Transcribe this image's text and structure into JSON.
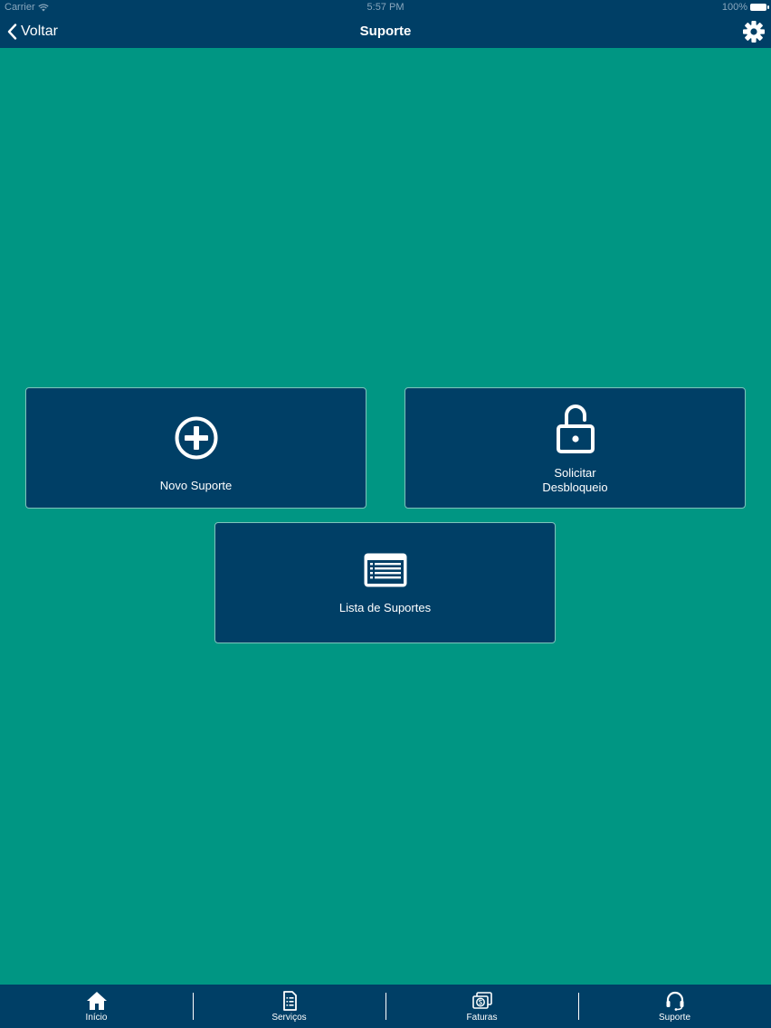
{
  "status_bar": {
    "carrier": "Carrier",
    "time": "5:57 PM",
    "battery": "100%"
  },
  "nav_bar": {
    "back_label": "Voltar",
    "title": "Suporte",
    "settings_icon": "gear-icon"
  },
  "tiles": {
    "novo_suporte": {
      "label": "Novo Suporte",
      "icon": "plus-circle-icon"
    },
    "solicitar_desbloqueio": {
      "label_line1": "Solicitar",
      "label_line2": "Desbloqueio",
      "icon": "unlock-icon"
    },
    "lista_suportes": {
      "label": "Lista de Suportes",
      "icon": "list-icon"
    }
  },
  "tab_bar": {
    "items": [
      {
        "label": "Início",
        "icon": "home-icon"
      },
      {
        "label": "Serviços",
        "icon": "document-icon"
      },
      {
        "label": "Faturas",
        "icon": "invoice-icon"
      },
      {
        "label": "Suporte",
        "icon": "headset-icon"
      }
    ]
  },
  "colors": {
    "background": "#009683",
    "bars": "#003f66",
    "tile_border": "#7fc3bb",
    "text": "#ffffff"
  }
}
